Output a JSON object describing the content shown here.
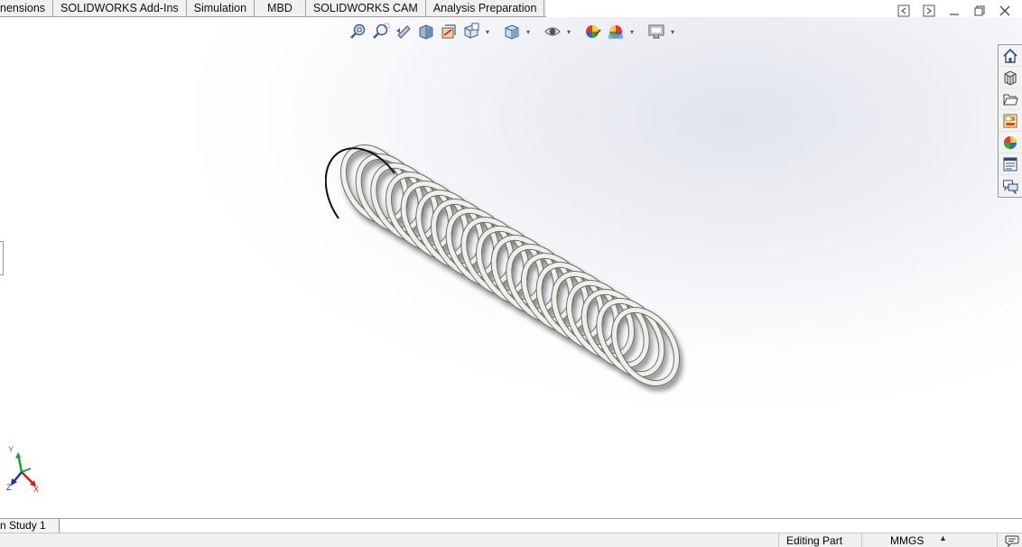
{
  "tabs": [
    {
      "label": "nensions"
    },
    {
      "label": "SOLIDWORKS Add-Ins"
    },
    {
      "label": "Simulation"
    },
    {
      "label": "MBD"
    },
    {
      "label": "SOLIDWORKS CAM"
    },
    {
      "label": "Analysis Preparation"
    }
  ],
  "window_controls": [
    "restore-left-icon",
    "restore-right-icon",
    "minimize-icon",
    "maximize-icon",
    "close-icon"
  ],
  "heads_up_toolbar": [
    "zoom-to-fit",
    "zoom-to-area",
    "previous-view",
    "section-view",
    "dynamic-annotation-views",
    "view-orientation",
    "display-style",
    "hide-show-items",
    "edit-appearance",
    "apply-scene",
    "view-settings"
  ],
  "task_pane": [
    "home",
    "design-library",
    "file-explorer",
    "view-palette",
    "appearances-scenes-decals",
    "custom-properties",
    "forum"
  ],
  "triad": {
    "y": "Y",
    "x": "X",
    "z": "Z"
  },
  "bottom_tab": {
    "label": "n Study 1"
  },
  "status": {
    "mode": "Editing Part",
    "units": "MMGS",
    "units_caret": "▲"
  },
  "colors": {
    "spring": "#f1efe9",
    "spring_edge": "#6e6e6e",
    "background_top": "#e2e4ec"
  }
}
